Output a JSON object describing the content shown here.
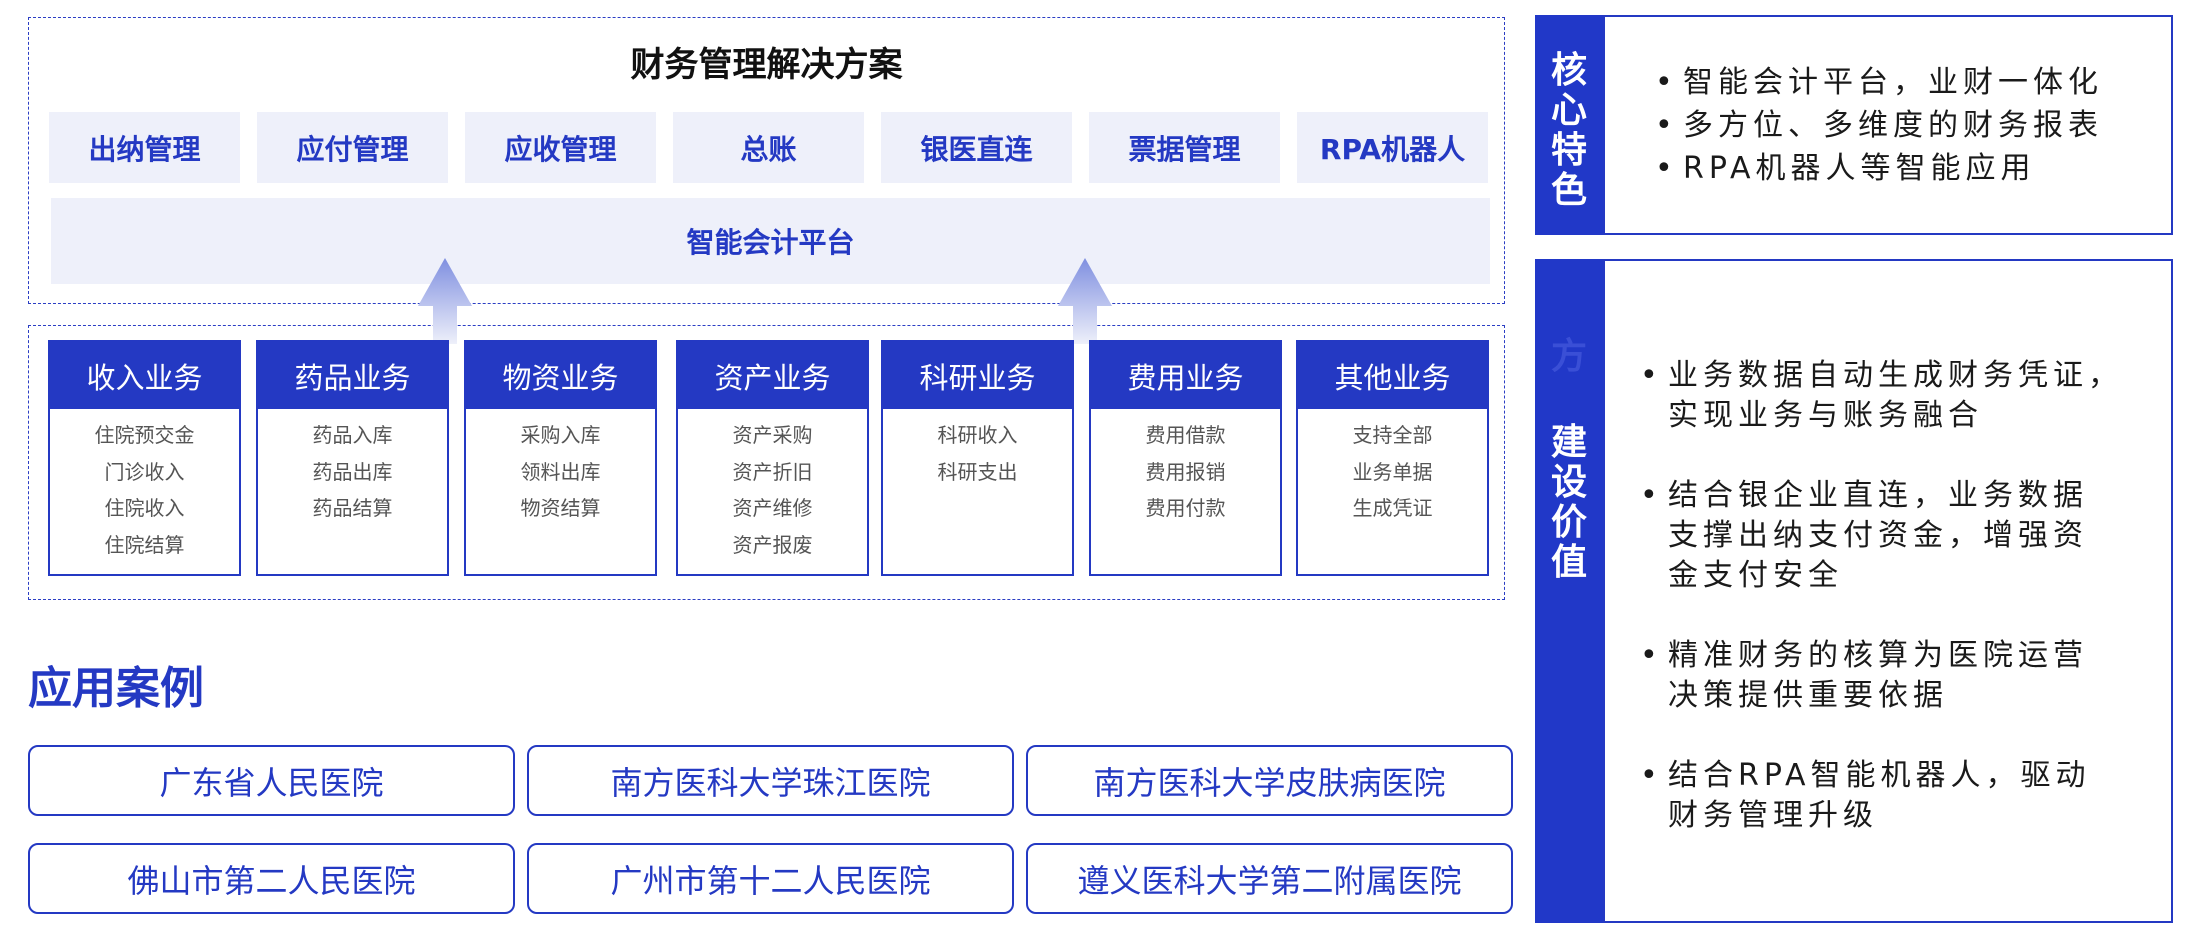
{
  "solution": {
    "title": "财务管理解决方案",
    "modules": [
      "出纳管理",
      "应付管理",
      "应收管理",
      "总账",
      "银医直连",
      "票据管理",
      "RPA机器人"
    ],
    "platform": "智能会计平台"
  },
  "businesses": [
    {
      "title": "收入业务",
      "items": [
        "住院预交金",
        "门诊收入",
        "住院收入",
        "住院结算"
      ]
    },
    {
      "title": "药品业务",
      "items": [
        "药品入库",
        "药品出库",
        "药品结算"
      ]
    },
    {
      "title": "物资业务",
      "items": [
        "采购入库",
        "领料出库",
        "物资结算"
      ]
    },
    {
      "title": "资产业务",
      "items": [
        "资产采购",
        "资产折旧",
        "资产维修",
        "资产报废"
      ]
    },
    {
      "title": "科研业务",
      "items": [
        "科研收入",
        "科研支出"
      ]
    },
    {
      "title": "费用业务",
      "items": [
        "费用借款",
        "费用报销",
        "费用付款"
      ]
    },
    {
      "title": "其他业务",
      "items": [
        "支持全部",
        "业务单据",
        "生成凭证"
      ]
    }
  ],
  "cases": {
    "title": "应用案例",
    "items": [
      "广东省人民医院",
      "南方医科大学珠江医院",
      "南方医科大学皮肤病医院",
      "佛山市第二人民医院",
      "广州市第十二人民医院",
      "遵义医科大学第二附属医院"
    ]
  },
  "core": {
    "label_lines": [
      "核",
      "心",
      "特",
      "色"
    ],
    "bullets": [
      "智能会计平台，业财一体化",
      "多方位、多维度的财务报表",
      "RPA机器人等智能应用"
    ]
  },
  "value": {
    "ghost_char": "方",
    "label_lines": [
      "建",
      "设",
      "价",
      "值"
    ],
    "bullets": [
      [
        "业务数据自动生成财务凭证，",
        "实现业务与账务融合"
      ],
      [
        "结合银企业直连，业务数据",
        "支撑出纳支付资金，增强资",
        "金支付安全"
      ],
      [
        "精准财务的核算为医院运营",
        "决策提供重要依据"
      ],
      [
        "结合RPA智能机器人，驱动",
        "财务管理升级"
      ]
    ]
  },
  "colors": {
    "accent": "#2439c3",
    "panel": "#eef0fa",
    "sidebar": "#2138c8"
  }
}
